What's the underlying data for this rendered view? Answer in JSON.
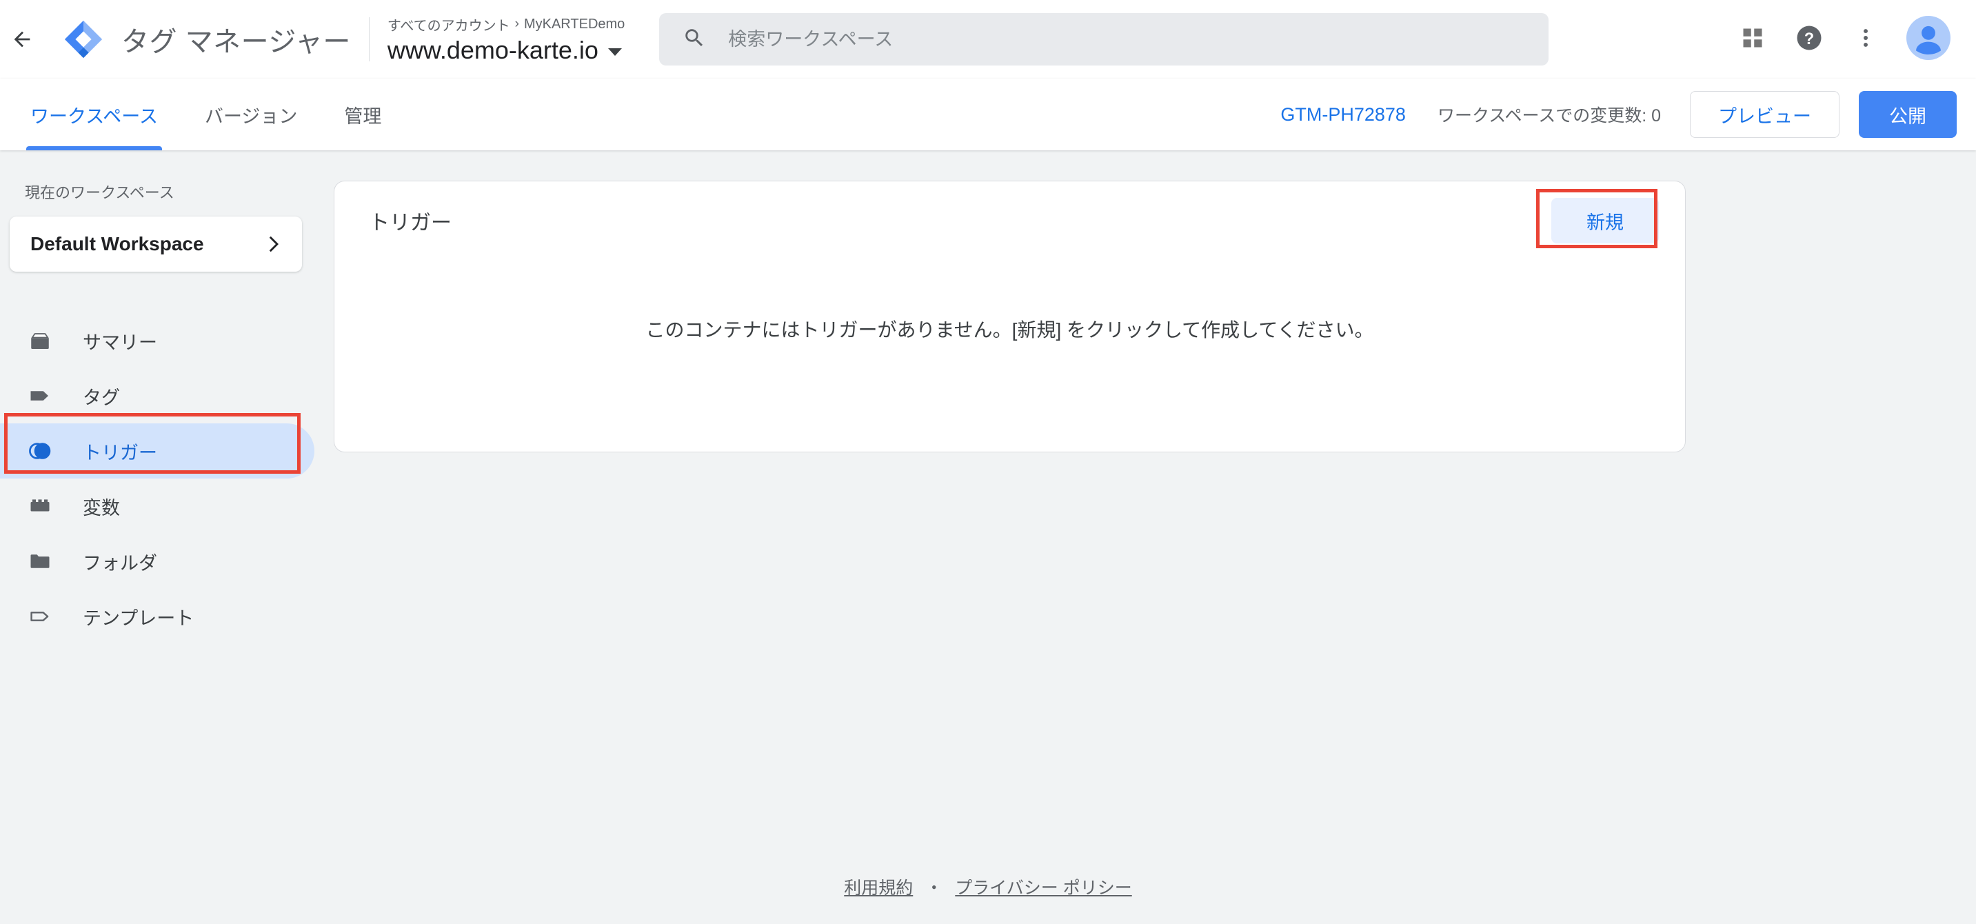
{
  "header": {
    "back_icon": "back-arrow-icon",
    "logo_icon": "google-tag-manager-logo",
    "product_title": "タグ マネージャー",
    "breadcrumb_account": "すべてのアカウント",
    "breadcrumb_separator": "›",
    "breadcrumb_container_group": "MyKARTEDemo",
    "container_name": "www.demo-karte.io",
    "search": {
      "icon": "search-icon",
      "placeholder": "検索ワークスペース",
      "value": ""
    },
    "actions": [
      {
        "name": "apps-grid-icon",
        "label": ""
      },
      {
        "name": "help-icon",
        "label": "?"
      },
      {
        "name": "more-vert-icon",
        "label": ""
      },
      {
        "name": "avatar",
        "label": ""
      }
    ]
  },
  "tabbar": {
    "tabs": [
      {
        "label": "ワークスペース",
        "active": true
      },
      {
        "label": "バージョン",
        "active": false
      },
      {
        "label": "管理",
        "active": false
      }
    ],
    "gtm_id": "GTM-PH72878",
    "changes_label": "ワークスペースでの変更数: 0",
    "preview_label": "プレビュー",
    "publish_label": "公開"
  },
  "sidebar": {
    "workspace_label": "現在のワークスペース",
    "workspace_name": "Default Workspace",
    "workspace_chevron_icon": "chevron-right-icon",
    "items": [
      {
        "label": "サマリー",
        "icon": "summary-box-icon",
        "active": false
      },
      {
        "label": "タグ",
        "icon": "tag-icon",
        "active": false
      },
      {
        "label": "トリガー",
        "icon": "trigger-icon",
        "active": true
      },
      {
        "label": "変数",
        "icon": "variable-brick-icon",
        "active": false
      },
      {
        "label": "フォルダ",
        "icon": "folder-icon",
        "active": false
      },
      {
        "label": "テンプレート",
        "icon": "template-tag-icon",
        "active": false
      }
    ]
  },
  "main": {
    "card_title": "トリガー",
    "new_button_label": "新規",
    "empty_message": "このコンテナにはトリガーがありません。[新規] をクリックして作成してください。"
  },
  "footer": {
    "terms_label": "利用規約",
    "separator": "・",
    "privacy_label": "プライバシー ポリシー"
  },
  "annotations": [
    {
      "name": "trigger-nav-highlight",
      "color": "#ea4335"
    },
    {
      "name": "new-button-highlight",
      "color": "#ea4335"
    }
  ],
  "colors": {
    "accent_blue": "#1a73e8",
    "publish_blue": "#4285f4",
    "active_nav_bg": "#d2e3fc",
    "page_bg": "#f1f3f4",
    "annotation_red": "#ea4335"
  }
}
